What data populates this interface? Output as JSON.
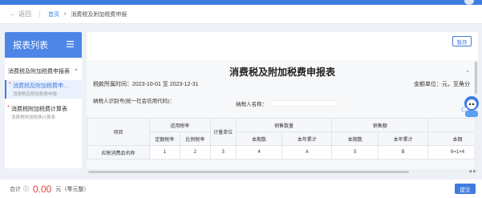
{
  "nav": {
    "back_label": "返回",
    "breadcrumb": {
      "home": "首页",
      "separator": "›",
      "current": "消费税及附加税费申报"
    }
  },
  "sidebar": {
    "title": "报表列表",
    "group_label": "消费税及附加税费申报表",
    "items": [
      {
        "label": "消费税及附加税费申…",
        "sub": "消费税及附加税费申报",
        "required": "*",
        "active": true
      },
      {
        "label": "消费税附加税费计算表",
        "sub": "消费税附加税费计算表",
        "required": "*",
        "active": false
      }
    ]
  },
  "toolbar": {
    "save_label": "暂存"
  },
  "form": {
    "title": "消费税及附加税费申报表",
    "period": "税款所属时间：2023-10-01 至 2023-12-31",
    "unit": "金额单位：元，至角分",
    "taxpayer_id_label": "纳税人识别号(统一社会信用代码)：",
    "taxpayer_name_label": "纳税人名称：",
    "taxpayer_name_value": ""
  },
  "table": {
    "h_project": "项目",
    "h_rate": "适用税率",
    "h_unit": "计量单位",
    "h_qty": "销售数量",
    "h_amount": "销售额",
    "h_item_name": "应税消费品名称",
    "h_fixed": "定额税率",
    "h_ratio": "比例税率",
    "h_qty_period": "本期数",
    "h_qty_ytd": "本年累计",
    "h_amt_period": "本期数",
    "h_amt_ytd": "本年累计",
    "h_extra": "本期",
    "codes": [
      "1",
      "2",
      "3",
      "4",
      "A",
      "5",
      "B",
      "6=1×4"
    ]
  },
  "footer": {
    "total_label": "合计",
    "info_icon": "ⓘ",
    "amount": "0.00",
    "amount_text": "元（零元整）",
    "submit_label": "提交"
  },
  "colors": {
    "accent": "#3f7ce0",
    "sidebar_header": "#4d86e6",
    "amount": "#e0463a"
  },
  "icons": {
    "back": "back-arrow-icon",
    "menu": "menu-lines-icon",
    "collapse": "chevron-down-icon",
    "group": "chevron-up-icon",
    "mascot": "assistant-mascot-icon"
  }
}
